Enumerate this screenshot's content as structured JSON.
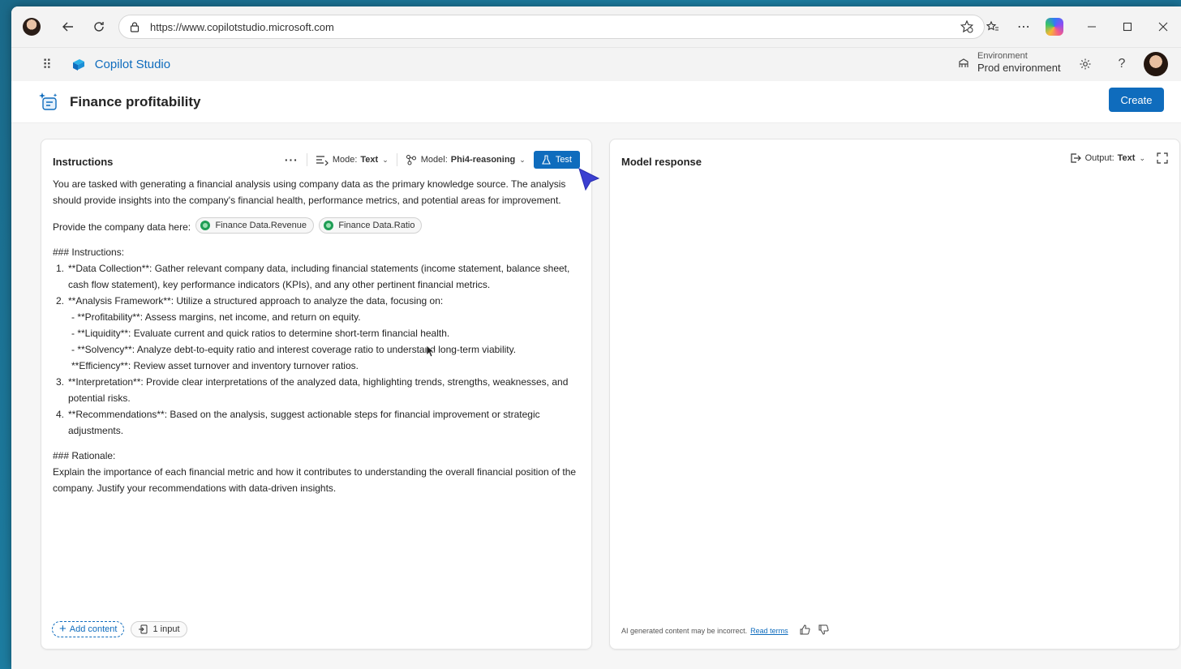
{
  "browser": {
    "url": "https://www.copilotstudio.microsoft.com"
  },
  "app": {
    "name": "Copilot Studio",
    "environment_label": "Environment",
    "environment_value": "Prod environment"
  },
  "page": {
    "title": "Finance profitability",
    "create_label": "Create"
  },
  "instructions": {
    "heading": "Instructions",
    "mode_label": "Mode:",
    "mode_value": "Text",
    "model_label": "Model:",
    "model_value": "Phi4-reasoning",
    "test_label": "Test",
    "intro": "You are tasked with generating a financial analysis using company data as the primary knowledge source. The analysis should provide insights into the company's financial health, performance metrics, and potential areas for improvement.",
    "provide_label": "Provide the company data here:",
    "chips": [
      "Finance Data.Revenue",
      "Finance Data.Ratio"
    ],
    "section_heading": "### Instructions:",
    "items": [
      {
        "num": "1.",
        "text": "**Data Collection**: Gather relevant company data, including financial statements (income statement, balance sheet, cash flow statement), key performance indicators (KPIs), and any other pertinent financial metrics."
      },
      {
        "num": "2.",
        "text": "**Analysis Framework**: Utilize a structured approach to analyze the data, focusing on:"
      }
    ],
    "sub_items": [
      "- **Profitability**: Assess margins, net income, and return on equity.",
      "- **Liquidity**: Evaluate current and quick ratios to determine short-term financial health.",
      "- **Solvency**: Analyze debt-to-equity ratio and interest coverage ratio to understand long-term viability.",
      "**Efficiency**: Review asset turnover and inventory turnover ratios."
    ],
    "items_after": [
      {
        "num": "3.",
        "text": "**Interpretation**: Provide clear interpretations of the analyzed data, highlighting trends, strengths, weaknesses, and potential risks."
      },
      {
        "num": "4.",
        "text": "**Recommendations**: Based on the analysis, suggest actionable steps for financial improvement or strategic adjustments."
      }
    ],
    "rationale_heading": "### Rationale:",
    "rationale": "Explain the importance of each financial metric and how it contributes to understanding the overall financial position of the company. Justify your recommendations with data-driven insights.",
    "add_content_label": "Add content",
    "input_count_label": "1 input"
  },
  "response": {
    "heading": "Model response",
    "output_label": "Output:",
    "output_value": "Text",
    "disclaimer": "AI generated content may be incorrect.",
    "read_terms": "Read terms"
  },
  "colors": {
    "accent": "#0f6cbd",
    "chip_dot": "#1f9d55"
  }
}
